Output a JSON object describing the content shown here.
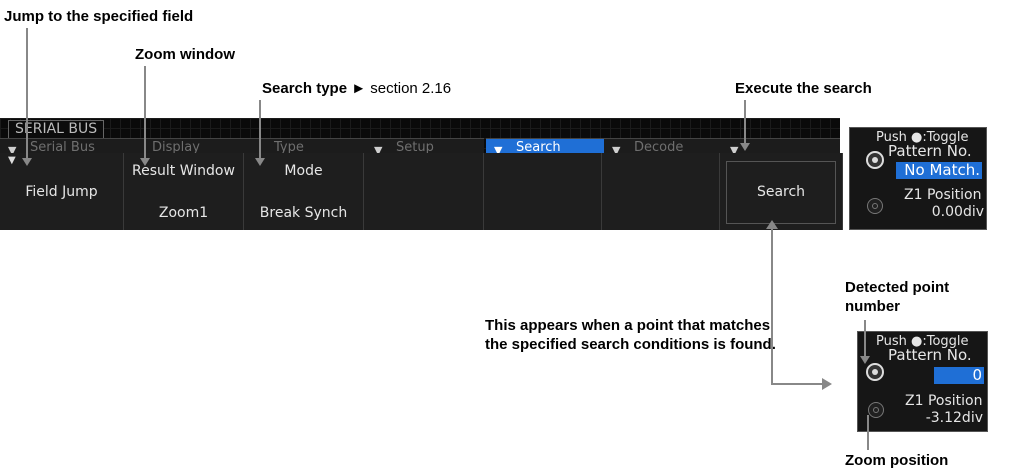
{
  "callouts": {
    "field_jump": "Jump to the specified field",
    "zoom_window": "Zoom window",
    "search_type": "Search type",
    "search_type_ref": "► section 2.16",
    "execute": "Execute the search",
    "detected_point": "Detected point number",
    "appears_when": "This appears when a point that matches the specified search conditions is found.",
    "zoom_position": "Zoom position"
  },
  "screen": {
    "bus_label": "SERIAL BUS",
    "tabs": [
      "Serial Bus",
      "Display",
      "Type",
      "Setup",
      "Search",
      "Decode"
    ],
    "active_tab": "Search",
    "softkeys": {
      "field_jump": "Field Jump",
      "result_window_label": "Result Window",
      "result_window_value": "Zoom1",
      "mode_label": "Mode",
      "mode_value": "Break Synch",
      "search": "Search"
    }
  },
  "panel_before": {
    "push_toggle": "Push ●:Toggle",
    "pattern_label": "Pattern No.",
    "pattern_value": "No Match.",
    "z1_label": "Z1 Position",
    "z1_value": "0.00div"
  },
  "panel_after": {
    "push_toggle": "Push ●:Toggle",
    "pattern_label": "Pattern No.",
    "pattern_value": "0",
    "z1_label": "Z1 Position",
    "z1_value": "-3.12div"
  }
}
